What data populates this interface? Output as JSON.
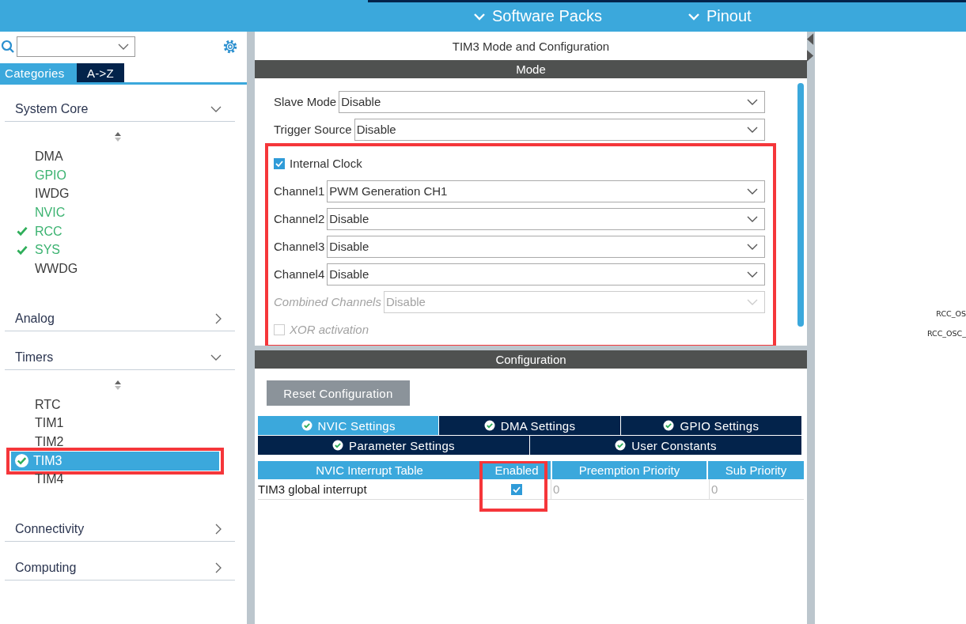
{
  "top_nav": [
    {
      "label": "Software Packs"
    },
    {
      "label": "Pinout"
    }
  ],
  "sidebar": {
    "tabs": [
      {
        "label": "Categories",
        "selected": true
      },
      {
        "label": "A->Z",
        "selected": false
      }
    ],
    "categories": [
      {
        "label": "System Core",
        "expanded": true,
        "items": [
          {
            "label": "DMA",
            "configured": false,
            "checked": false,
            "selected": false,
            "highlighted": false
          },
          {
            "label": "GPIO",
            "configured": true,
            "checked": false,
            "selected": false,
            "highlighted": false
          },
          {
            "label": "IWDG",
            "configured": false,
            "checked": false,
            "selected": false,
            "highlighted": false
          },
          {
            "label": "NVIC",
            "configured": true,
            "checked": false,
            "selected": false,
            "highlighted": false
          },
          {
            "label": "RCC",
            "configured": true,
            "checked": true,
            "selected": false,
            "highlighted": false
          },
          {
            "label": "SYS",
            "configured": true,
            "checked": true,
            "selected": false,
            "highlighted": false
          },
          {
            "label": "WWDG",
            "configured": false,
            "checked": false,
            "selected": false,
            "highlighted": false
          }
        ]
      },
      {
        "label": "Analog",
        "expanded": false
      },
      {
        "label": "Timers",
        "expanded": true,
        "items": [
          {
            "label": "RTC",
            "configured": false,
            "checked": false,
            "selected": false,
            "highlighted": false
          },
          {
            "label": "TIM1",
            "configured": false,
            "checked": false,
            "selected": false,
            "highlighted": false
          },
          {
            "label": "TIM2",
            "configured": false,
            "checked": false,
            "selected": false,
            "highlighted": false
          },
          {
            "label": "TIM3",
            "configured": false,
            "checked": true,
            "selected": true,
            "highlighted": true
          },
          {
            "label": "TIM4",
            "configured": false,
            "checked": false,
            "selected": false,
            "highlighted": false
          }
        ]
      },
      {
        "label": "Connectivity",
        "expanded": false
      },
      {
        "label": "Computing",
        "expanded": false
      }
    ]
  },
  "mode_panel": {
    "title": "TIM3 Mode and Configuration",
    "header": "Mode",
    "groups": [
      {
        "highlighted": false,
        "fields": [
          {
            "kind": "select",
            "label": "Slave Mode",
            "value": "Disable",
            "disabled": false
          },
          {
            "kind": "select",
            "label": "Trigger Source",
            "value": "Disable",
            "disabled": false
          }
        ]
      },
      {
        "highlighted": true,
        "fields": [
          {
            "kind": "checkbox",
            "label": "Internal Clock",
            "checked": true,
            "disabled": false
          },
          {
            "kind": "select",
            "label": "Channel1",
            "value": "PWM Generation CH1",
            "disabled": false
          },
          {
            "kind": "select",
            "label": "Channel2",
            "value": "Disable",
            "disabled": false
          },
          {
            "kind": "select",
            "label": "Channel3",
            "value": "Disable",
            "disabled": false
          },
          {
            "kind": "select",
            "label": "Channel4",
            "value": "Disable",
            "disabled": false
          },
          {
            "kind": "select",
            "label": "Combined Channels",
            "value": "Disable",
            "disabled": true
          },
          {
            "kind": "checkbox",
            "label": "XOR activation",
            "checked": false,
            "disabled": true
          }
        ]
      }
    ]
  },
  "config_panel": {
    "header": "Configuration",
    "reset_button": "Reset Configuration",
    "tab_rows": [
      [
        {
          "label": "NVIC Settings",
          "selected": true
        },
        {
          "label": "DMA Settings",
          "selected": false
        },
        {
          "label": "GPIO Settings",
          "selected": false
        }
      ],
      [
        {
          "label": "Parameter Settings",
          "selected": false
        },
        {
          "label": "User Constants",
          "selected": false
        }
      ]
    ],
    "table": {
      "columns": [
        {
          "label": "NVIC Interrupt Table",
          "highlighted": false
        },
        {
          "label": "Enabled",
          "highlighted": true
        },
        {
          "label": "Preemption Priority",
          "highlighted": false
        },
        {
          "label": "Sub Priority",
          "highlighted": false
        }
      ],
      "rows": [
        {
          "name": "TIM3 global interrupt",
          "enabled": true,
          "preemption_priority": "0",
          "sub_priority": "0"
        }
      ]
    }
  },
  "pinout_canvas": {
    "labels": [
      "RCC_OS",
      "RCC_OSC_"
    ]
  }
}
